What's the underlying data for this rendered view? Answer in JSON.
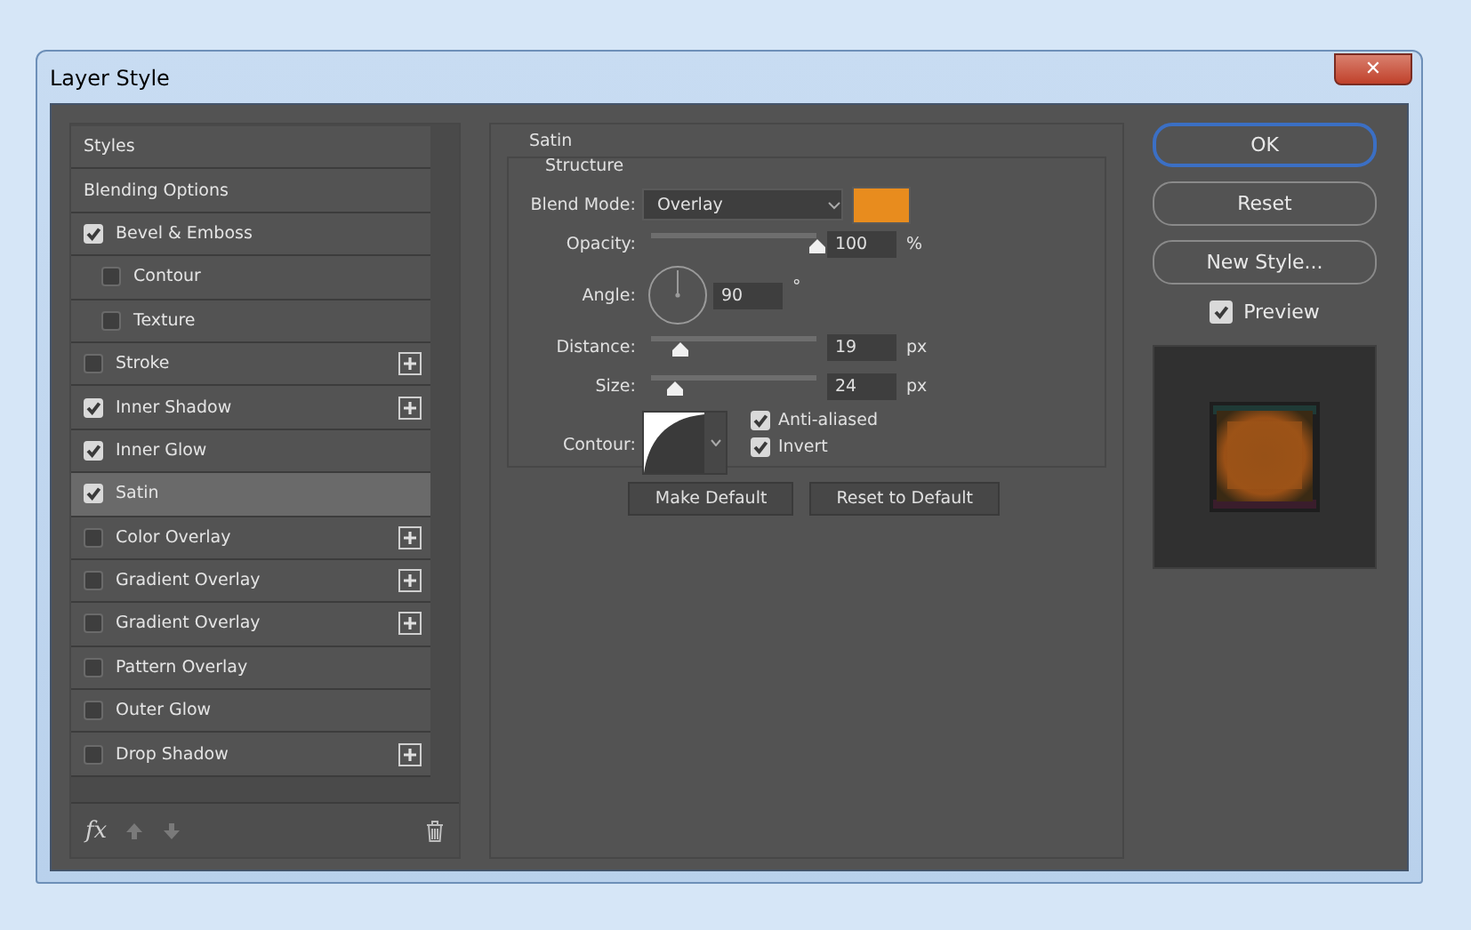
{
  "window": {
    "title": "Layer Style",
    "close": "✕"
  },
  "styles_list": [
    {
      "label": "Styles",
      "kind": "header",
      "selected": false
    },
    {
      "label": "Blending Options",
      "kind": "header",
      "selected": false
    },
    {
      "label": "Bevel & Emboss",
      "kind": "effect",
      "checked": true,
      "selected": false,
      "addable": false,
      "children": [
        {
          "label": "Contour",
          "kind": "effect",
          "checked": false,
          "selected": false,
          "addable": false
        },
        {
          "label": "Texture",
          "kind": "effect",
          "checked": false,
          "selected": false,
          "addable": false
        }
      ]
    },
    {
      "label": "Stroke",
      "kind": "effect",
      "checked": false,
      "selected": false,
      "addable": true
    },
    {
      "label": "Inner Shadow",
      "kind": "effect",
      "checked": true,
      "selected": false,
      "addable": true
    },
    {
      "label": "Inner Glow",
      "kind": "effect",
      "checked": true,
      "selected": false,
      "addable": false
    },
    {
      "label": "Satin",
      "kind": "effect",
      "checked": true,
      "selected": true,
      "addable": false
    },
    {
      "label": "Color Overlay",
      "kind": "effect",
      "checked": false,
      "selected": false,
      "addable": true
    },
    {
      "label": "Gradient Overlay",
      "kind": "effect",
      "checked": false,
      "selected": false,
      "addable": true
    },
    {
      "label": "Gradient Overlay",
      "kind": "effect",
      "checked": false,
      "selected": false,
      "addable": true
    },
    {
      "label": "Pattern Overlay",
      "kind": "effect",
      "checked": false,
      "selected": false,
      "addable": false
    },
    {
      "label": "Outer Glow",
      "kind": "effect",
      "checked": false,
      "selected": false,
      "addable": false
    },
    {
      "label": "Drop Shadow",
      "kind": "effect",
      "checked": false,
      "selected": false,
      "addable": true
    }
  ],
  "list_toolbar": {
    "fx": "fx"
  },
  "satin": {
    "title": "Satin",
    "group": "Structure",
    "blend_mode": {
      "label": "Blend Mode:",
      "value": "Overlay",
      "color": "#e88c1e"
    },
    "opacity": {
      "label": "Opacity:",
      "level": 1.0,
      "value": "100",
      "unit": "%"
    },
    "angle": {
      "label": "Angle:",
      "value": "90",
      "unit": "°"
    },
    "distance": {
      "label": "Distance:",
      "level": 0.17,
      "value": "19",
      "unit": "px"
    },
    "size": {
      "label": "Size:",
      "level": 0.14,
      "value": "24",
      "unit": "px"
    },
    "contour": {
      "label": "Contour:",
      "options": [
        {
          "label": "Anti-aliased",
          "checked": true
        },
        {
          "label": "Invert",
          "checked": true
        }
      ]
    },
    "buttons": [
      "Make Default",
      "Reset to Default"
    ]
  },
  "actions": [
    {
      "label": "OK",
      "selected": true
    },
    {
      "label": "Reset",
      "selected": false
    },
    {
      "label": "New Style...",
      "selected": false
    }
  ],
  "preview": {
    "label": "Preview",
    "checked": true
  }
}
